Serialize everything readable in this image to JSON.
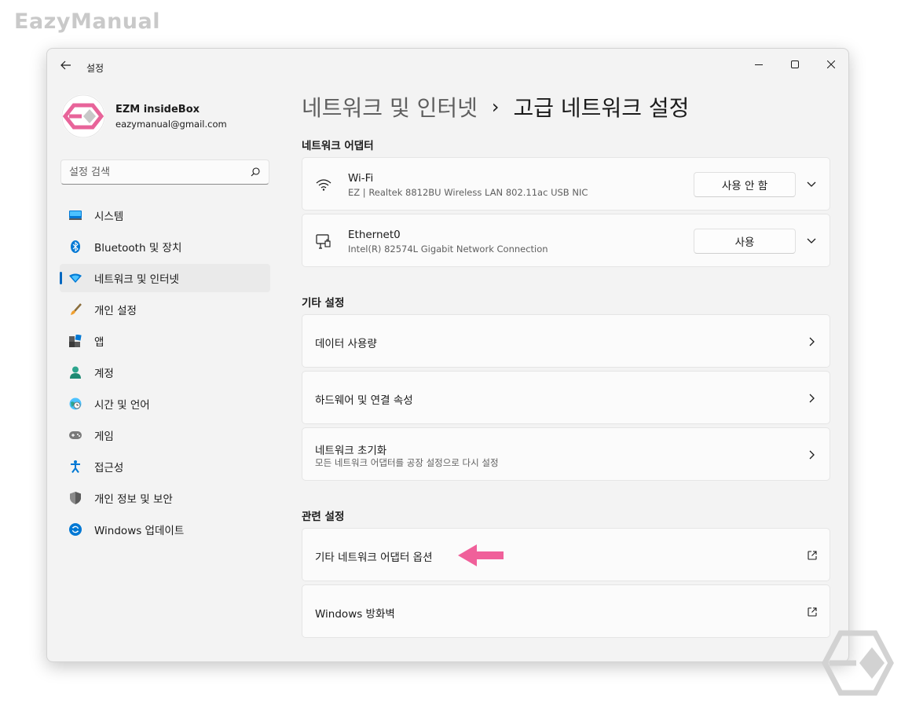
{
  "watermark": "EazyManual",
  "window": {
    "title": "설정"
  },
  "profile": {
    "name": "EZM insideBox",
    "email": "eazymanual@gmail.com"
  },
  "search": {
    "placeholder": "설정 검색"
  },
  "nav": {
    "items": [
      {
        "label": "시스템",
        "icon": "system-icon"
      },
      {
        "label": "Bluetooth 및 장치",
        "icon": "bluetooth-icon"
      },
      {
        "label": "네트워크 및 인터넷",
        "icon": "network-icon",
        "active": true
      },
      {
        "label": "개인 설정",
        "icon": "brush-icon"
      },
      {
        "label": "앱",
        "icon": "apps-icon"
      },
      {
        "label": "계정",
        "icon": "account-icon"
      },
      {
        "label": "시간 및 언어",
        "icon": "globe-clock-icon"
      },
      {
        "label": "게임",
        "icon": "gamepad-icon"
      },
      {
        "label": "접근성",
        "icon": "accessibility-icon"
      },
      {
        "label": "개인 정보 및 보안",
        "icon": "shield-icon"
      },
      {
        "label": "Windows 업데이트",
        "icon": "update-icon"
      }
    ]
  },
  "breadcrumb": {
    "parent": "네트워크 및 인터넷",
    "separator": "›",
    "current": "고급 네트워크 설정"
  },
  "sections": {
    "adapters": {
      "title": "네트워크 어댑터",
      "items": [
        {
          "name": "Wi-Fi",
          "description": "EZ | Realtek 8812BU Wireless LAN 802.11ac USB NIC",
          "button": "사용 안 함",
          "icon": "wifi-icon"
        },
        {
          "name": "Ethernet0",
          "description": "Intel(R) 82574L Gigabit Network Connection",
          "button": "사용",
          "icon": "ethernet-icon"
        }
      ]
    },
    "more": {
      "title": "기타 설정",
      "items": [
        {
          "title": "데이터 사용량"
        },
        {
          "title": "하드웨어 및 연결 속성"
        },
        {
          "title": "네트워크 초기화",
          "subtitle": "모든 네트워크 어댑터를 공장 설정으로 다시 설정"
        }
      ]
    },
    "related": {
      "title": "관련 설정",
      "items": [
        {
          "title": "기타 네트워크 어댑터 옵션"
        },
        {
          "title": "Windows 방화벽"
        }
      ]
    }
  },
  "colors": {
    "accent": "#0067c0",
    "annotation_arrow": "#f0609a",
    "logo_pink": "#e8649a"
  }
}
